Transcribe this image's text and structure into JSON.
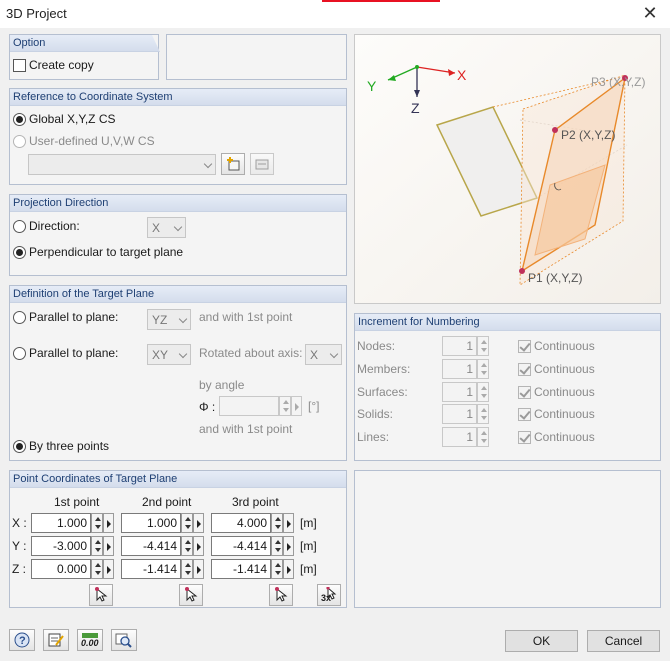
{
  "window": {
    "title": "3D Project",
    "close_glyph": "✕"
  },
  "option": {
    "header": "Option",
    "create_copy": "Create copy"
  },
  "reference": {
    "header": "Reference to Coordinate System",
    "global": "Global X,Y,Z CS",
    "user_defined": "User-defined U,V,W CS",
    "cs_value": ""
  },
  "projection": {
    "header": "Projection Direction",
    "direction": "Direction:",
    "direction_axis": "X",
    "perpendicular": "Perpendicular to target plane"
  },
  "target_plane": {
    "header": "Definition of the Target Plane",
    "parallel1": "Parallel to plane:",
    "plane1": "YZ",
    "first_point_1": "and with 1st point",
    "parallel2": "Parallel to plane:",
    "plane2": "XY",
    "rotated_about": "Rotated about axis:",
    "rotation_axis": "X",
    "by_angle": "by angle",
    "phi_symbol": "Φ :",
    "angle_value": "",
    "angle_unit": "[°]",
    "first_point_2": "and with 1st point",
    "three_points": "By three points"
  },
  "point_coordinates": {
    "header": "Point Coordinates of Target Plane",
    "columns": [
      "1st point",
      "2nd point",
      "3rd point"
    ],
    "rows": [
      {
        "axis": "X :",
        "values": [
          "1.000",
          "1.000",
          "4.000"
        ],
        "unit": "[m]"
      },
      {
        "axis": "Y :",
        "values": [
          "-3.000",
          "-4.414",
          "-4.414"
        ],
        "unit": "[m]"
      },
      {
        "axis": "Z :",
        "values": [
          "0.000",
          "-1.414",
          "-1.414"
        ],
        "unit": "[m]"
      }
    ],
    "pick_3x_label": "3x"
  },
  "preview": {
    "axis_x": "X",
    "axis_y": "Y",
    "axis_z": "Z",
    "p1": "P1 (X,Y,Z)",
    "p2": "P2 (X,Y,Z)",
    "p3": "P3 (X,Y,Z)"
  },
  "increment": {
    "header": "Increment for Numbering",
    "rows": [
      {
        "label": "Nodes:",
        "value": "1",
        "continuous": "Continuous"
      },
      {
        "label": "Members:",
        "value": "1",
        "continuous": "Continuous"
      },
      {
        "label": "Surfaces:",
        "value": "1",
        "continuous": "Continuous"
      },
      {
        "label": "Solids:",
        "value": "1",
        "continuous": "Continuous"
      },
      {
        "label": "Lines:",
        "value": "1",
        "continuous": "Continuous"
      }
    ]
  },
  "footer": {
    "ok": "OK",
    "cancel": "Cancel",
    "units_icon_label": "0.00"
  },
  "colors": {
    "accent": "#1e3f73",
    "plane_orange": "#e8892a",
    "point_red": "#c0305a"
  }
}
